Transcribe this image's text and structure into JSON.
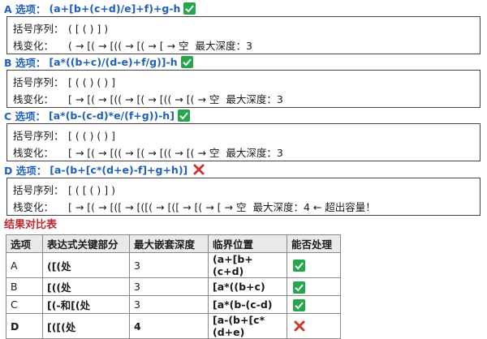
{
  "options": [
    {
      "title": "A 选项：",
      "expr": "(a+[b+(c+d)/e]+f)+g-h",
      "ok": true,
      "seq_label": "括号序列：",
      "seq": "( [ ( ) ] )",
      "stack_label": "栈变化：",
      "stack": "( → [( → [(( → [( → [ → 空",
      "depth": "最大深度：3"
    },
    {
      "title": "B 选项：",
      "expr": "[a*((b+c)/(d-e)+f/g)]-h",
      "ok": true,
      "seq_label": "括号序列：",
      "seq": "[ ( ( ) ( ) ]",
      "stack_label": "栈变化：",
      "stack": "[ → [( → [(( → [( → [(( → [( → 空",
      "depth": "最大深度：3"
    },
    {
      "title": "C 选项：",
      "expr": "[a*(b-(c-d)*e/(f+g))-h]",
      "ok": true,
      "seq_label": "括号序列：",
      "seq": "[ ( ( ) ( ) ]",
      "stack_label": "栈变化：",
      "stack": "[ → [( → [(( → [( → [(( → [( → 空",
      "depth": "最大深度：3"
    },
    {
      "title": "D 选项：",
      "expr": "[a-(b+[c*(d+e)-f]+g+h)]",
      "ok": false,
      "seq_label": "括号序列：",
      "seq": "[ ( [ ( ) ] )",
      "stack_label": "栈变化：",
      "stack": "[ → [( → [([ → [([( → [([ → [( → [ → 空",
      "depth": "最大深度：4 ← 超出容量！"
    }
  ],
  "result": {
    "title": "结果对比表",
    "headers": [
      "选项",
      "表达式关键部分",
      "最大嵌套深度",
      "临界位置",
      "能否处理"
    ],
    "rows": [
      {
        "opt": "A",
        "key": "([(处",
        "depth": "3",
        "pos": "(a+[b+(c+d)",
        "ok": true
      },
      {
        "opt": "B",
        "key": "[((处",
        "depth": "3",
        "pos": "[a*((b+c)",
        "ok": true
      },
      {
        "opt": "C",
        "key": "[(-和[(处",
        "depth": "3",
        "pos": "[a*(b-(c-d)",
        "ok": true
      },
      {
        "opt": "D",
        "key": "[([(处",
        "depth": "4",
        "pos": "[a-(b+[c*(d+e)",
        "ok": false
      }
    ]
  },
  "colors": {
    "title_blue": "#1f5fbf",
    "check_green": "#22a84a",
    "cross_red": "#d0352b",
    "section_red": "#c0282f"
  }
}
